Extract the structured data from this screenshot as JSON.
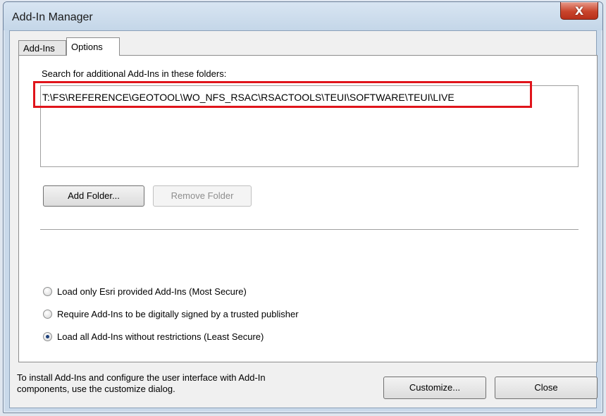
{
  "window": {
    "title": "Add-In Manager",
    "close_symbol": "X"
  },
  "tabs": [
    {
      "label": "Add-Ins",
      "active": false
    },
    {
      "label": "Options",
      "active": true
    }
  ],
  "options": {
    "search_label": "Search for additional Add-Ins in these folders:",
    "folders": [
      "T:\\FS\\REFERENCE\\GEOTOOL\\WO_NFS_RSAC\\RSACTOOLS\\TEUI\\SOFTWARE\\TEUI\\LIVE"
    ],
    "add_folder_label": "Add Folder...",
    "remove_folder_label": "Remove Folder",
    "security": [
      {
        "label": "Load only Esri provided Add-Ins (Most Secure)",
        "checked": false
      },
      {
        "label": "Require Add-Ins to be digitally signed by a trusted publisher",
        "checked": false
      },
      {
        "label": "Load all Add-Ins without restrictions (Least Secure)",
        "checked": true
      }
    ]
  },
  "footer": {
    "text_line1": "To install Add-Ins and configure the user interface with Add-In",
    "text_line2": "components, use the customize dialog.",
    "customize_label": "Customize...",
    "close_label": "Close"
  },
  "colors": {
    "highlight_border": "#e0141b",
    "title_close": "#c9452c"
  },
  "icons": {
    "close": "close-icon",
    "radio": "radio-icon"
  }
}
